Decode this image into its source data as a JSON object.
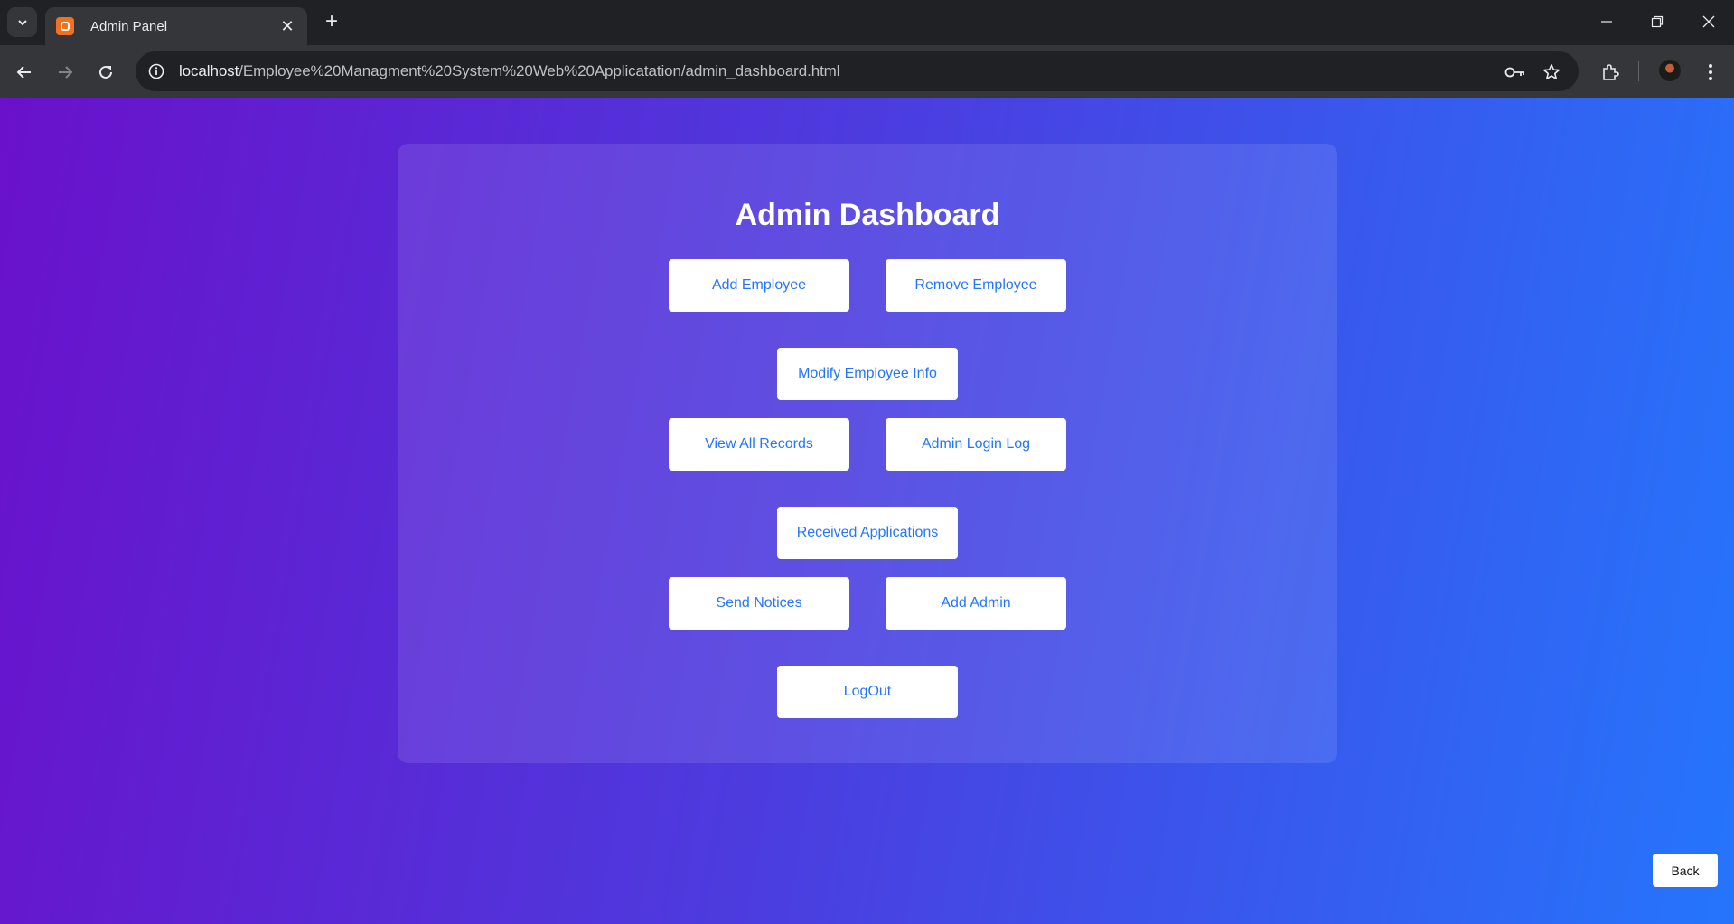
{
  "browser": {
    "tab_title": "Admin Panel",
    "url_host": "localhost",
    "url_path": "/Employee%20Managment%20System%20Web%20Applicatation/admin_dashboard.html",
    "icons": [
      "tab-search-icon",
      "favicon-icon",
      "close-icon",
      "plus-icon",
      "minimize-icon",
      "restore-icon",
      "window-close-icon",
      "back-arrow-icon",
      "forward-arrow-icon",
      "reload-icon",
      "site-info-icon",
      "key-icon",
      "star-icon",
      "extensions-icon",
      "profile-avatar",
      "kebab-menu-icon"
    ]
  },
  "dashboard": {
    "title": "Admin Dashboard",
    "buttons": {
      "add_employee": "Add Employee",
      "remove_employee": "Remove Employee",
      "modify_employee": "Modify Employee Info",
      "view_records": "View All Records",
      "login_log": "Admin Login Log",
      "received_applications": "Received Applications",
      "send_notices": "Send Notices",
      "add_admin": "Add Admin",
      "logout": "LogOut"
    },
    "accent_color": "#2575fc",
    "gradient": [
      "#6a11cb",
      "#2575fc"
    ]
  },
  "back_label": "Back"
}
